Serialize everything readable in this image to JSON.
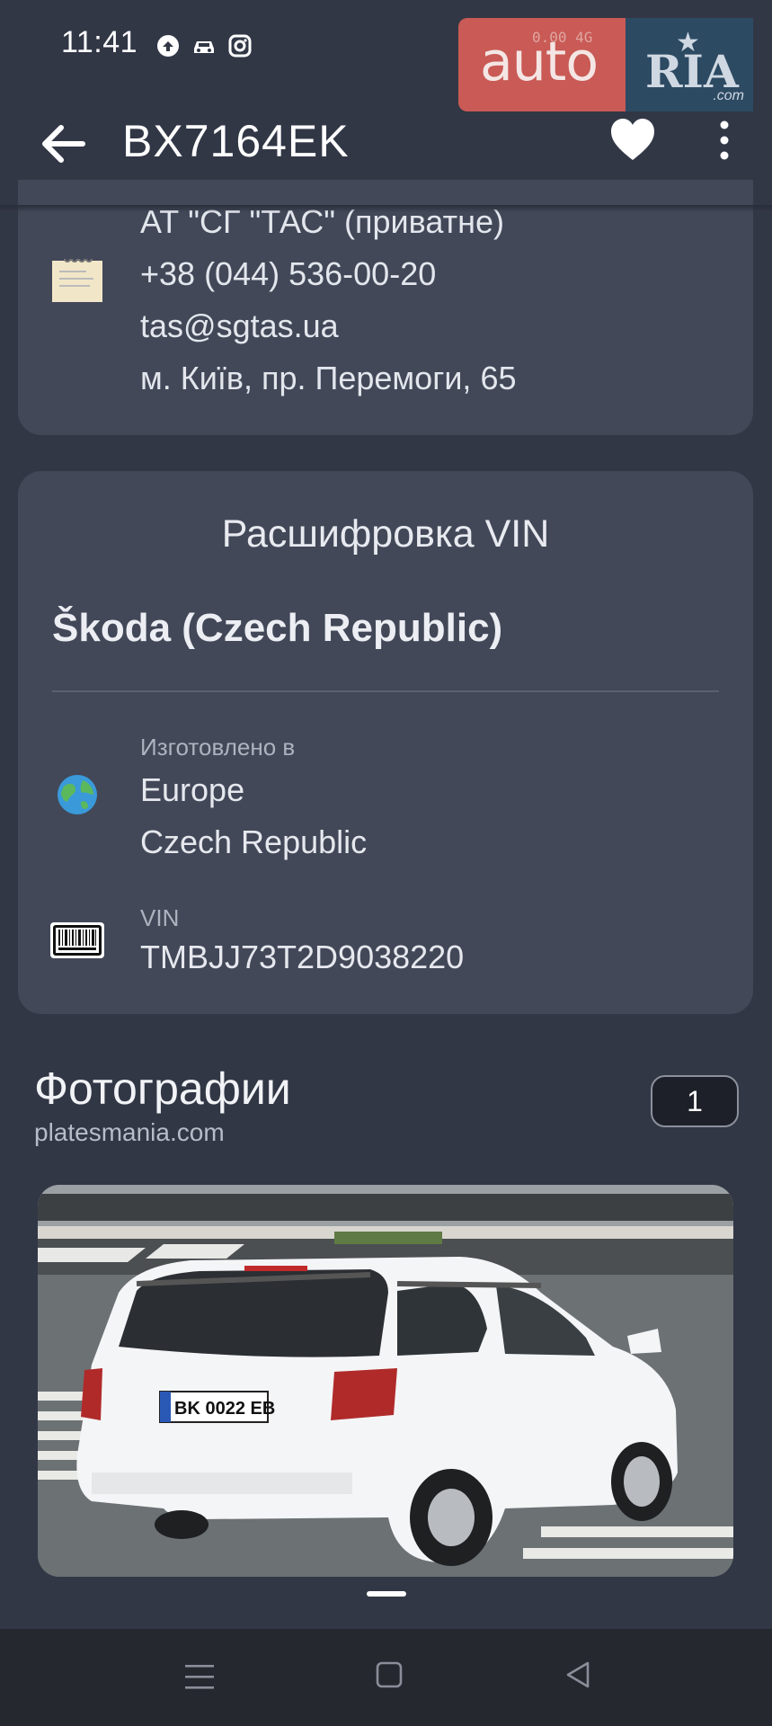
{
  "status_bar": {
    "time": "11:41",
    "network_text": "0.00 4G"
  },
  "logo": {
    "auto": "auto",
    "ria": "RIA",
    "com": ".com"
  },
  "app_bar": {
    "title": "BX7164EK"
  },
  "insurer": {
    "name": "АТ \"СГ \"ТАС\" (приватне)",
    "phone": "+38 (044) 536-00-20",
    "email": "tas@sgtas.ua",
    "address": "м. Київ, пр. Перемоги, 65"
  },
  "vin_card": {
    "title": "Расшифровка VIN",
    "brand": "Škoda (Czech Republic)",
    "made_in_label": "Изготовлено в",
    "region": "Europe",
    "country": "Czech Republic",
    "vin_label": "VIN",
    "vin": "TMBJJ73T2D9038220"
  },
  "photos": {
    "title": "Фотографии",
    "source": "platesmania.com",
    "count": "1",
    "plate_text": "BK 0022 EB"
  },
  "icons": [
    "globe-icon",
    "barcode-icon",
    "document-icon",
    "heart-icon",
    "back-arrow-icon",
    "more-vert-icon"
  ],
  "colors": {
    "background": "#323746",
    "card": "#424858",
    "logo_auto": "#c95a55",
    "logo_ria": "#2d4a63"
  }
}
